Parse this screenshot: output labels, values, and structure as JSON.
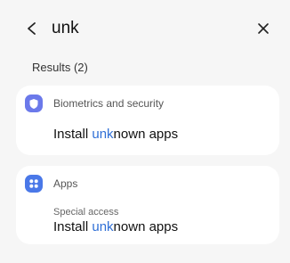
{
  "header": {
    "query": "unk",
    "back_icon": "chevron-left-icon",
    "close_icon": "close-icon"
  },
  "results_label": "Results (2)",
  "highlight_color": "#2f6fd6",
  "results": [
    {
      "category": "Biometrics and security",
      "category_icon": "shield-icon",
      "category_color": "#6b79ea",
      "title_prefix": "Install ",
      "title_highlight": "unk",
      "title_suffix": "nown apps"
    },
    {
      "category": "Apps",
      "category_icon": "apps-grid-icon",
      "category_color": "#4a78e8",
      "subtitle": "Special access",
      "title_prefix": "Install ",
      "title_highlight": "unk",
      "title_suffix": "nown apps"
    }
  ]
}
